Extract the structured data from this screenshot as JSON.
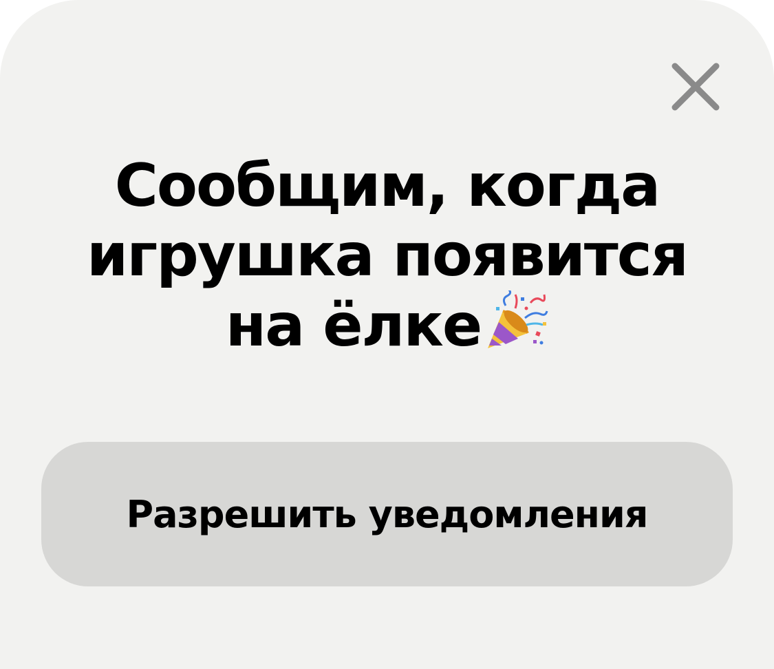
{
  "dialog": {
    "title_lines": [
      "Сообщим, когда",
      "игрушка появится",
      "на ёлке"
    ],
    "title_emoji": "party-popper-icon",
    "allow_button_label": "Разрешить уведомления",
    "close_icon": "close-icon"
  },
  "colors": {
    "sheet_background": "#f2f2f0",
    "button_background": "#d7d7d5",
    "close_icon": "#8a8a8a",
    "text": "#000000"
  }
}
